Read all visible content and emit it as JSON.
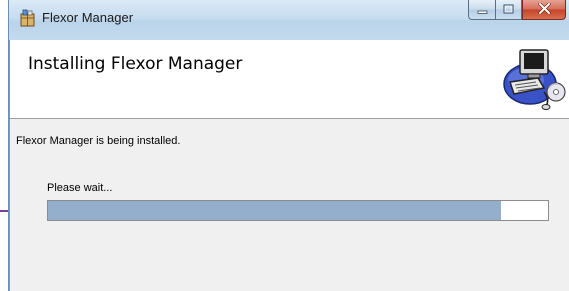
{
  "window": {
    "title": "Flexor Manager",
    "icon": "installer-package-icon"
  },
  "caption_buttons": {
    "minimize_icon": "minimize-icon",
    "maximize_icon": "maximize-icon",
    "close_icon": "close-icon",
    "close_color": "#c9472f"
  },
  "header": {
    "title": "Installing Flexor Manager",
    "graphic_icon": "computer-setup-icon"
  },
  "body": {
    "status": "Flexor Manager is being installed.",
    "wait_label": "Please wait..."
  },
  "progress": {
    "fraction": 0.905,
    "fill_color": "#93afcc"
  }
}
